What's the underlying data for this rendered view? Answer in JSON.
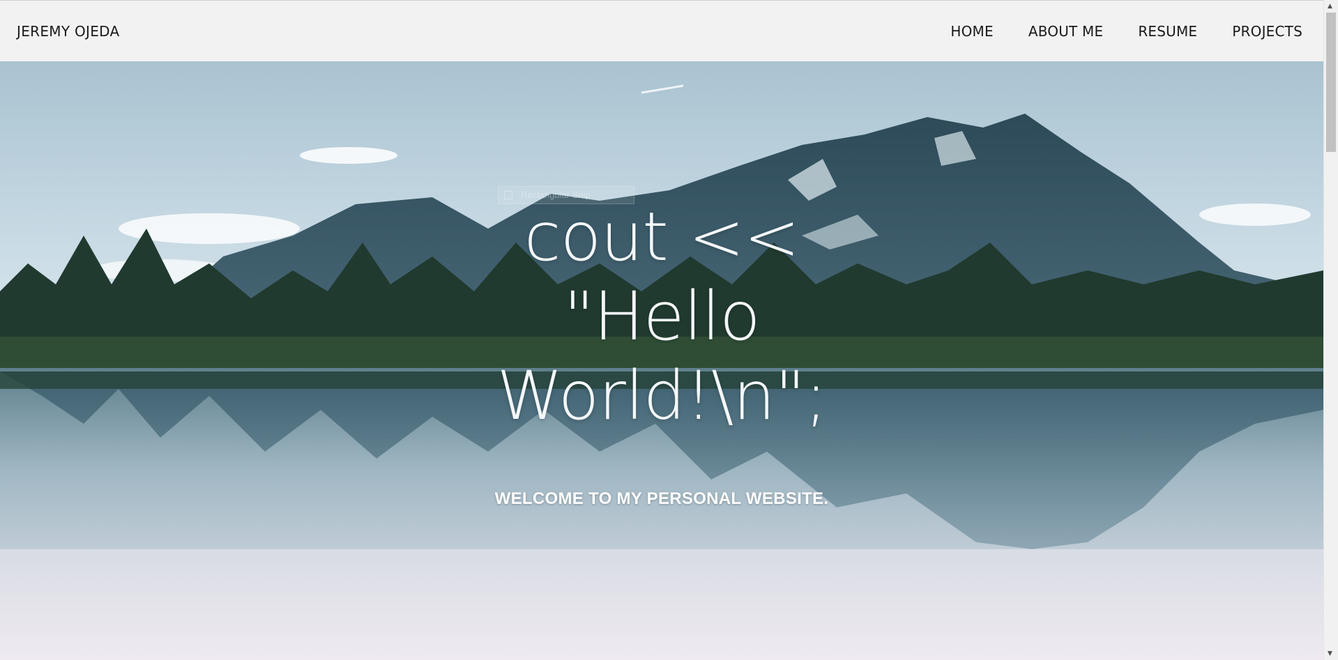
{
  "nav": {
    "brand": "JEREMY OJEDA",
    "links": [
      "HOME",
      "ABOUT ME",
      "RESUME",
      "PROJECTS"
    ]
  },
  "hero": {
    "headline": [
      "cout <<",
      "\"Hello",
      "World!\\n\";"
    ],
    "subtitle": "WELCOME TO MY PERSONAL WEBSITE.",
    "ghost_label": "Rectangular Snip"
  },
  "colors": {
    "nav_background": "#f2f2f2",
    "nav_text": "#1a1a1a",
    "hero_text": "#f4f7f9"
  },
  "icons": [
    "rectangular-snip-icon",
    "scroll-up-arrow-icon",
    "scroll-down-arrow-icon"
  ]
}
